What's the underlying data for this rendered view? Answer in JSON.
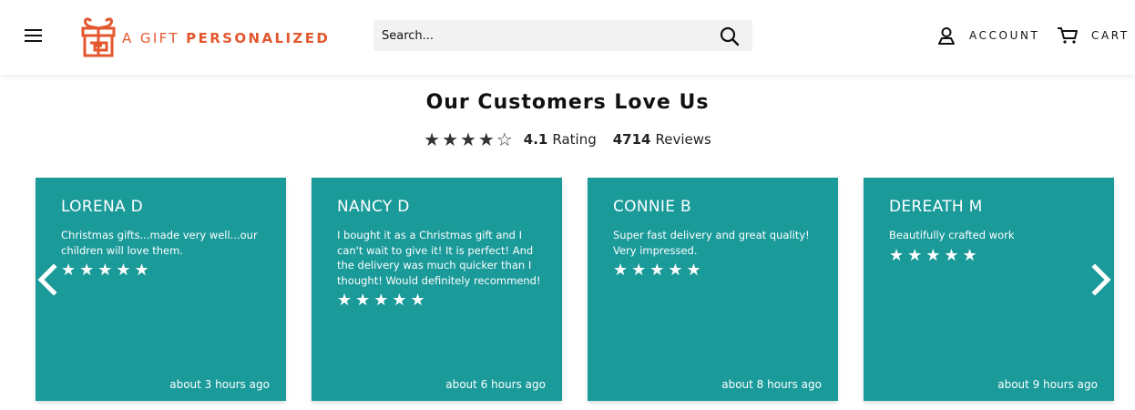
{
  "brand": {
    "name_light": "A GIFT ",
    "name_bold": "PERSONALIZED",
    "color": "#e4572e"
  },
  "header": {
    "menu_icon": "hamburger-icon",
    "search": {
      "placeholder": "Search...",
      "icon": "search-icon"
    },
    "account_label": "ACCOUNT",
    "account_icon": "user-icon",
    "cart_label": "CART",
    "cart_icon": "cart-icon"
  },
  "reviews_section": {
    "title": "Our Customers Love Us",
    "rating_stars": "★★★★☆",
    "rating_value": "4.1",
    "rating_label": "Rating",
    "rating_out_of": 5,
    "review_count": "4714",
    "review_label": "Reviews",
    "card_color": "#1b9a9a",
    "cards": [
      {
        "name": "LORENA D",
        "text": "Christmas gifts...made very well...our children will love them.",
        "stars": "★★★★★",
        "rating": 5,
        "time": "about 3 hours ago"
      },
      {
        "name": "NANCY D",
        "text": "I bought it as a Christmas gift and I can't wait to give it! It is perfect! And the delivery was much quicker than I thought! Would definitely recommend!",
        "stars": "★★★★★",
        "rating": 5,
        "time": "about 6 hours ago"
      },
      {
        "name": "CONNIE B",
        "text": "Super fast delivery and great quality! Very impressed.",
        "stars": "★★★★★",
        "rating": 5,
        "time": "about 8 hours ago"
      },
      {
        "name": "DEREATH M",
        "text": "Beautifully crafted work",
        "stars": "★★★★★",
        "rating": 5,
        "time": "about 9 hours ago"
      }
    ],
    "prev_icon": "chevron-left-icon",
    "next_icon": "chevron-right-icon"
  }
}
